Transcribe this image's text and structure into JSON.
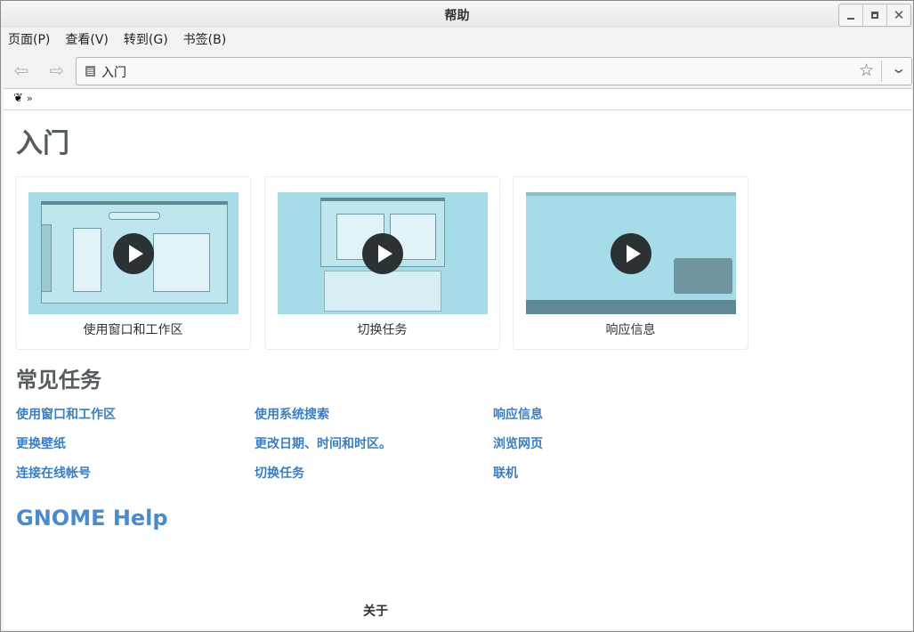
{
  "window": {
    "title": "帮助"
  },
  "menu": {
    "items": [
      "页面(P)",
      "查看(V)",
      "转到(G)",
      "书签(B)"
    ]
  },
  "toolbar": {
    "back_icon": "back-arrow-icon",
    "forward_icon": "forward-arrow-icon"
  },
  "location": {
    "value": "入门"
  },
  "breadcrumb": {
    "home_icon": "gnome-foot-icon",
    "separator": "»"
  },
  "page": {
    "heading": "入门",
    "videos": [
      {
        "label": "使用窗口和工作区"
      },
      {
        "label": "切换任务"
      },
      {
        "label": "响应信息"
      }
    ],
    "common_tasks_heading": "常见任务",
    "tasks": [
      [
        "使用窗口和工作区",
        "使用系统搜索",
        "响应信息"
      ],
      [
        "更换壁纸",
        "更改日期、时间和时区。",
        "浏览网页"
      ],
      [
        "连接在线帐号",
        "切换任务",
        "联机"
      ]
    ],
    "help_link": "GNOME Help",
    "footer": "关于"
  },
  "colors": {
    "link": "#3b7ec0",
    "heading": "#555c5e",
    "thumb_bg": "#a6dce8"
  }
}
